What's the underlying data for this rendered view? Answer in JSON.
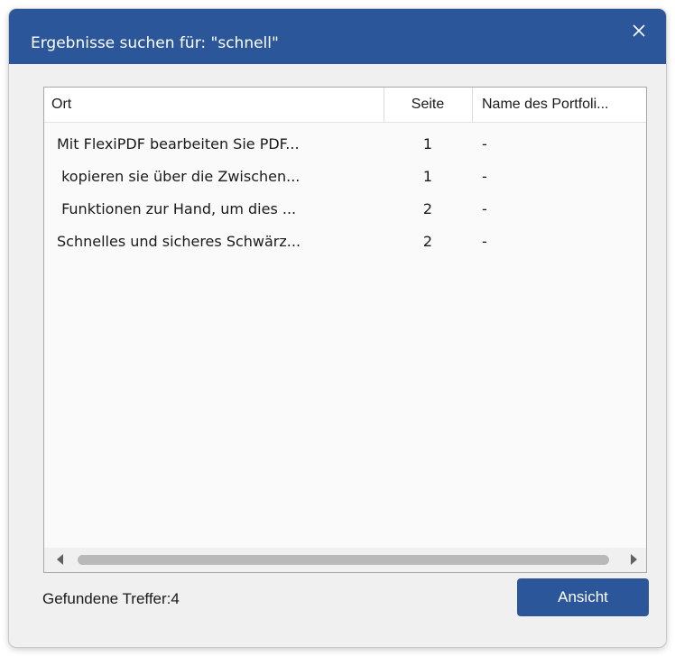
{
  "dialog": {
    "title": "Ergebnisse suchen für: \"schnell\"",
    "close_icon": "close-icon"
  },
  "table": {
    "columns": [
      "Ort",
      "Seite",
      "Name des Portfoli..."
    ],
    "rows": [
      {
        "ort": "Mit FlexiPDF bearbeiten Sie PDF...",
        "seite": "1",
        "portfolio": "-"
      },
      {
        "ort": " kopieren sie über die Zwischen...",
        "seite": "1",
        "portfolio": "-"
      },
      {
        "ort": " Funktionen zur Hand, um dies ...",
        "seite": "2",
        "portfolio": "-"
      },
      {
        "ort": "Schnelles und sicheres Schwärz...",
        "seite": "2",
        "portfolio": "-"
      }
    ]
  },
  "footer": {
    "found_label": "Gefundene Treffer:4",
    "view_button": "Ansicht"
  },
  "colors": {
    "accent": "#2b579a",
    "dialog_bg": "#f0f0f0"
  }
}
